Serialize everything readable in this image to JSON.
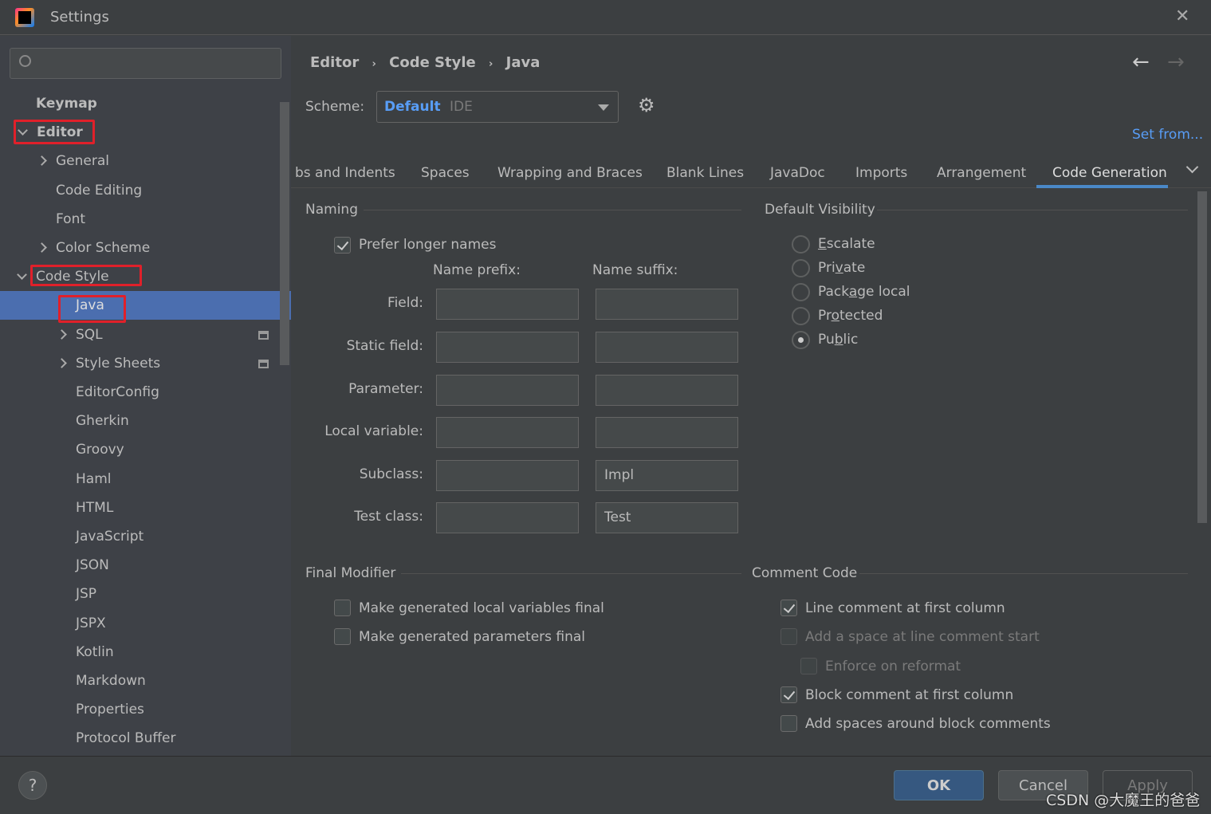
{
  "window": {
    "title": "Settings",
    "close_icon": "close-icon"
  },
  "search": {
    "placeholder": ""
  },
  "sidebar": {
    "items": [
      {
        "label": "Keymap",
        "bold": true
      },
      {
        "label": "Editor",
        "bold": true,
        "expanded": true
      },
      {
        "label": "General"
      },
      {
        "label": "Code Editing"
      },
      {
        "label": "Font"
      },
      {
        "label": "Color Scheme"
      },
      {
        "label": "Code Style",
        "expanded": true
      },
      {
        "label": "Java",
        "selected": true
      },
      {
        "label": "SQL"
      },
      {
        "label": "Style Sheets"
      },
      {
        "label": "EditorConfig"
      },
      {
        "label": "Gherkin"
      },
      {
        "label": "Groovy"
      },
      {
        "label": "Haml"
      },
      {
        "label": "HTML"
      },
      {
        "label": "JavaScript"
      },
      {
        "label": "JSON"
      },
      {
        "label": "JSP"
      },
      {
        "label": "JSPX"
      },
      {
        "label": "Kotlin"
      },
      {
        "label": "Markdown"
      },
      {
        "label": "Properties"
      },
      {
        "label": "Protocol Buffer"
      }
    ]
  },
  "breadcrumb": [
    "Editor",
    "Code Style",
    "Java"
  ],
  "scheme": {
    "label": "Scheme:",
    "name": "Default",
    "type": "IDE",
    "set_from": "Set from..."
  },
  "tabs": [
    "bs and Indents",
    "Spaces",
    "Wrapping and Braces",
    "Blank Lines",
    "JavaDoc",
    "Imports",
    "Arrangement",
    "Code Generation"
  ],
  "active_tab": "Code Generation",
  "naming": {
    "title": "Naming",
    "prefer_longer": "Prefer longer names",
    "prefer_longer_checked": true,
    "prefix_header": "Name prefix:",
    "suffix_header": "Name suffix:",
    "rows": [
      {
        "label": "Field:",
        "prefix": "",
        "suffix": ""
      },
      {
        "label": "Static field:",
        "prefix": "",
        "suffix": ""
      },
      {
        "label": "Parameter:",
        "prefix": "",
        "suffix": ""
      },
      {
        "label": "Local variable:",
        "prefix": "",
        "suffix": ""
      },
      {
        "label": "Subclass:",
        "prefix": "",
        "suffix": "Impl"
      },
      {
        "label": "Test class:",
        "prefix": "",
        "suffix": "Test"
      }
    ]
  },
  "visibility": {
    "title": "Default Visibility",
    "options": [
      "Escalate",
      "Private",
      "Package local",
      "Protected",
      "Public"
    ],
    "selected": "Public"
  },
  "final_modifier": {
    "title": "Final Modifier",
    "options": [
      {
        "label": "Make generated local variables final",
        "checked": false
      },
      {
        "label": "Make generated parameters final",
        "checked": false
      }
    ]
  },
  "comment_code": {
    "title": "Comment Code",
    "options": [
      {
        "label": "Line comment at first column",
        "checked": true
      },
      {
        "label": "Add a space at line comment start",
        "checked": false,
        "disabled": true
      },
      {
        "label": "Enforce on reformat",
        "checked": false,
        "disabled": true
      },
      {
        "label": "Block comment at first column",
        "checked": true
      },
      {
        "label": "Add spaces around block comments",
        "checked": false
      }
    ]
  },
  "footer": {
    "help": "?",
    "ok": "OK",
    "cancel": "Cancel",
    "apply": "Apply"
  },
  "watermark": "CSDN @大魔王的爸爸",
  "colors": {
    "accent": "#589df6",
    "selection": "#4b6eaf",
    "highlight_box": "#e0202a"
  }
}
